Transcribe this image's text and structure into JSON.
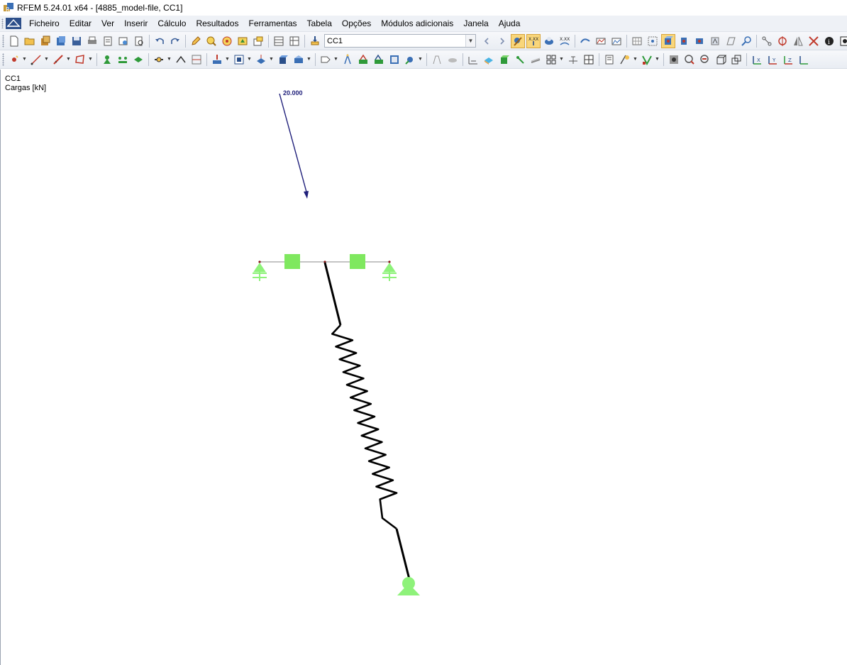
{
  "window": {
    "title": "RFEM 5.24.01 x64 - [4885_model-file, CC1]"
  },
  "menu": {
    "items": [
      {
        "label": "Ficheiro"
      },
      {
        "label": "Editar"
      },
      {
        "label": "Ver"
      },
      {
        "label": "Inserir"
      },
      {
        "label": "Cálculo"
      },
      {
        "label": "Resultados"
      },
      {
        "label": "Ferramentas"
      },
      {
        "label": "Tabela"
      },
      {
        "label": "Opções"
      },
      {
        "label": "Módulos adicionais"
      },
      {
        "label": "Janela"
      },
      {
        "label": "Ajuda"
      }
    ]
  },
  "toolbar": {
    "load_case_value": "CC1"
  },
  "viewport": {
    "load_case": "CC1",
    "result_label": "Cargas [kN]",
    "load_value": "20.000"
  },
  "colors": {
    "support": "#8ef27a",
    "load_arrow": "#1f1f7a",
    "member": "#000000",
    "menubar": "#eef1f6"
  }
}
